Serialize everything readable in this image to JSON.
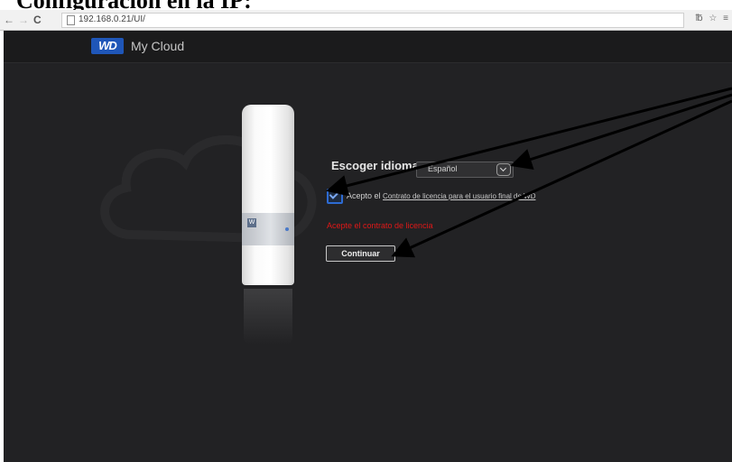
{
  "document": {
    "heading": "Configuración en la IP:"
  },
  "browser": {
    "url": "192.168.0.21/UI/",
    "back_icon": "←",
    "forward_icon": "→",
    "reload_icon": "C",
    "right_icons": "℔ ☆ ≡"
  },
  "header": {
    "logo_text": "WD",
    "app_name": "My Cloud"
  },
  "device": {
    "badge": "W"
  },
  "form": {
    "language_label": "Escoger idioma",
    "language_value": "Español",
    "accept_prefix": "Acepto el",
    "accept_link": "Contrato de licencia para el usuario final de WD",
    "error": "Acepte el contrato de licencia",
    "continue_label": "Continuar"
  },
  "colors": {
    "brand": "#1f56b8",
    "error": "#e01818",
    "page_background": "#222224"
  }
}
